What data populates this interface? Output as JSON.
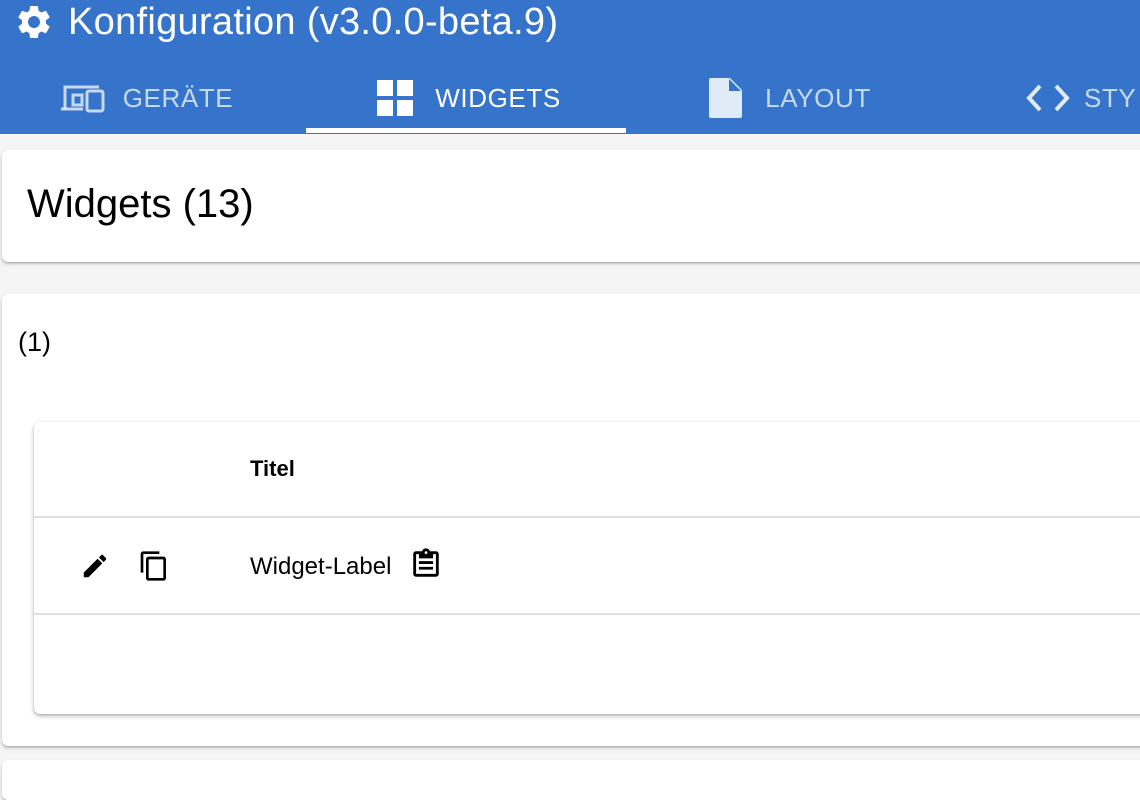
{
  "app": {
    "title": "Konfiguration (v3.0.0-beta.9)",
    "title_icon": "gear-icon"
  },
  "tabs": [
    {
      "label": "GERÄTE",
      "icon": "devices-icon",
      "active": false
    },
    {
      "label": "WIDGETS",
      "icon": "widgets-grid-icon",
      "active": true
    },
    {
      "label": "LAYOUT",
      "icon": "document-icon",
      "active": false
    },
    {
      "label": "STY",
      "icon": "code-icon",
      "active": false
    }
  ],
  "page": {
    "heading": "Widgets (13)"
  },
  "group": {
    "label": "(1)",
    "table": {
      "columns": [
        "",
        "Titel"
      ],
      "rows": [
        {
          "actions": [
            "edit-icon",
            "copy-icon"
          ],
          "title": "Widget-Label",
          "title_icon": "clipboard-icon"
        }
      ]
    }
  },
  "colors": {
    "appbar": "#3674cb",
    "indicator": "#ffffff",
    "background": "#f5f5f5"
  }
}
